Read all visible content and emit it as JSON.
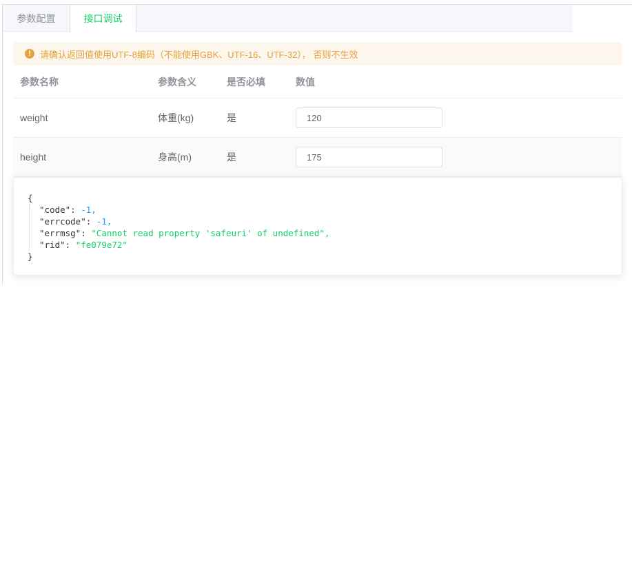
{
  "tabs": [
    {
      "label": "参数配置",
      "active": false
    },
    {
      "label": "接口调试",
      "active": true
    }
  ],
  "alert": {
    "icon": "warning-icon",
    "text": "请确认返回值使用UTF-8编码（不能使用GBK、UTF-16、UTF-32）， 否则不生效"
  },
  "table": {
    "headers": [
      "参数名称",
      "参数含义",
      "是否必填",
      "数值"
    ],
    "rows": [
      {
        "name": "weight",
        "meaning": "体重(kg)",
        "required": "是",
        "value": "120"
      },
      {
        "name": "height",
        "meaning": "身高(m)",
        "required": "是",
        "value": "175"
      }
    ]
  },
  "result": {
    "open": "{",
    "close": "}",
    "lines": [
      {
        "key": "\"code\"",
        "value": "-1,",
        "kind": "num"
      },
      {
        "key": "\"errcode\"",
        "value": "-1,",
        "kind": "num"
      },
      {
        "key": "\"errmsg\"",
        "value": "\"Cannot read property 'safeuri' of undefined\",",
        "kind": "str"
      },
      {
        "key": "\"rid\"",
        "value": "\"fe079e72\"",
        "kind": "str"
      }
    ]
  },
  "colors": {
    "accent": "#13ce66",
    "warning": "#e6a23c",
    "number": "#1e9bff"
  }
}
